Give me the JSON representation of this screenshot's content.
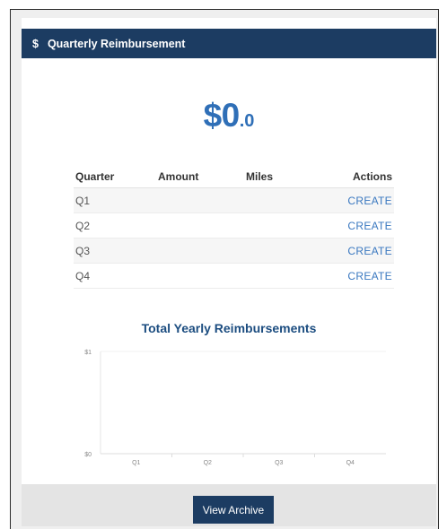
{
  "header": {
    "icon": "dollar-icon",
    "icon_glyph": "$",
    "title": "Quarterly Reimbursement"
  },
  "total": {
    "main": "$0",
    "decimal": ".0"
  },
  "table": {
    "columns": [
      "Quarter",
      "Amount",
      "Miles",
      "Actions"
    ],
    "rows": [
      {
        "quarter": "Q1",
        "amount": "",
        "miles": "",
        "action": "CREATE"
      },
      {
        "quarter": "Q2",
        "amount": "",
        "miles": "",
        "action": "CREATE"
      },
      {
        "quarter": "Q3",
        "amount": "",
        "miles": "",
        "action": "CREATE"
      },
      {
        "quarter": "Q4",
        "amount": "",
        "miles": "",
        "action": "CREATE"
      }
    ]
  },
  "chart_title": "Total Yearly Reimbursements",
  "chart_data": {
    "type": "bar",
    "title": "Total Yearly Reimbursements",
    "categories": [
      "Q1",
      "Q2",
      "Q3",
      "Q4"
    ],
    "values": [
      0,
      0,
      0,
      0
    ],
    "ylim": [
      0,
      1
    ],
    "yticks": [
      "$1",
      "$0"
    ],
    "grid": false
  },
  "footer": {
    "archive_label": "View Archive"
  },
  "colors": {
    "header": "#1c3c62",
    "accent": "#2f6fb7",
    "link": "#3a78c0"
  }
}
